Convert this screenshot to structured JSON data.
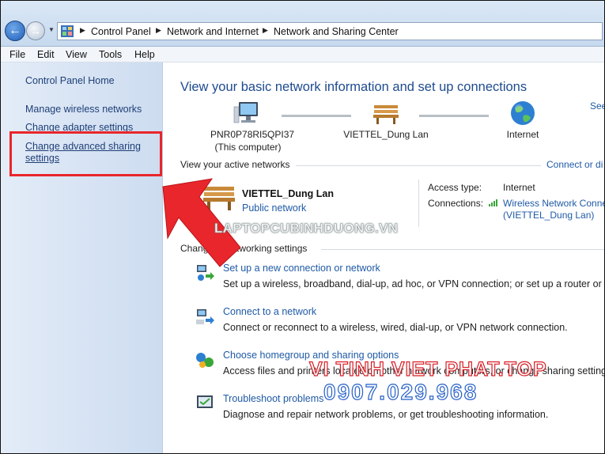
{
  "breadcrumbs": [
    "Control Panel",
    "Network and Internet",
    "Network and Sharing Center"
  ],
  "menu": [
    "File",
    "Edit",
    "View",
    "Tools",
    "Help"
  ],
  "sidebar": {
    "home": "Control Panel Home",
    "items": [
      "Manage wireless networks",
      "Change adapter settings",
      "Change advanced sharing",
      "settings"
    ]
  },
  "main": {
    "title": "View your basic network information and set up connections",
    "see_full_map": "See",
    "nodes": {
      "computer_name": "PNR0P78RI5QPI37",
      "computer_sub": "(This computer)",
      "network": "VIETTEL_Dung Lan",
      "internet": "Internet"
    },
    "active_header": "View your active networks",
    "connect_link": "Connect or di",
    "active": {
      "name": "VIETTEL_Dung Lan",
      "type": "Public network",
      "access_label": "Access type:",
      "access_value": "Internet",
      "connections_label": "Connections:",
      "connections_value": "Wireless Network Conne",
      "connections_sub": "(VIETTEL_Dung Lan)"
    },
    "change_header_start": "Chang",
    "change_header_end": "tworking settings",
    "tasks": [
      {
        "title": "Set up a new connection or network",
        "desc": "Set up a wireless, broadband, dial-up, ad hoc, or VPN connection; or set up a router or acce"
      },
      {
        "title": "Connect to a network",
        "desc": "Connect or reconnect to a wireless, wired, dial-up, or VPN network connection."
      },
      {
        "title": "Choose homegroup and sharing options",
        "desc": "Access files and printers located on other network computers, or change sharing settings."
      },
      {
        "title": "Troubleshoot problems",
        "desc": "Diagnose and repair network problems, or get troubleshooting information."
      }
    ]
  },
  "watermarks": {
    "site": "LAPTOPCUBINHDUONG.VN",
    "brand": "VI TINH VIET PHAT.TOP",
    "phone": "0907.029.968"
  },
  "colors": {
    "link": "#1f5aa6",
    "title": "#1e4b8f",
    "highlight": "#e8262b",
    "arrow": "#e8262b"
  },
  "icons": [
    "back-arrow-icon",
    "forward-arrow-icon",
    "control-panel-icon",
    "computer-icon",
    "bench-icon",
    "globe-icon",
    "wireless-signal-icon",
    "new-connection-icon",
    "connect-network-icon",
    "homegroup-icon",
    "troubleshoot-icon"
  ]
}
